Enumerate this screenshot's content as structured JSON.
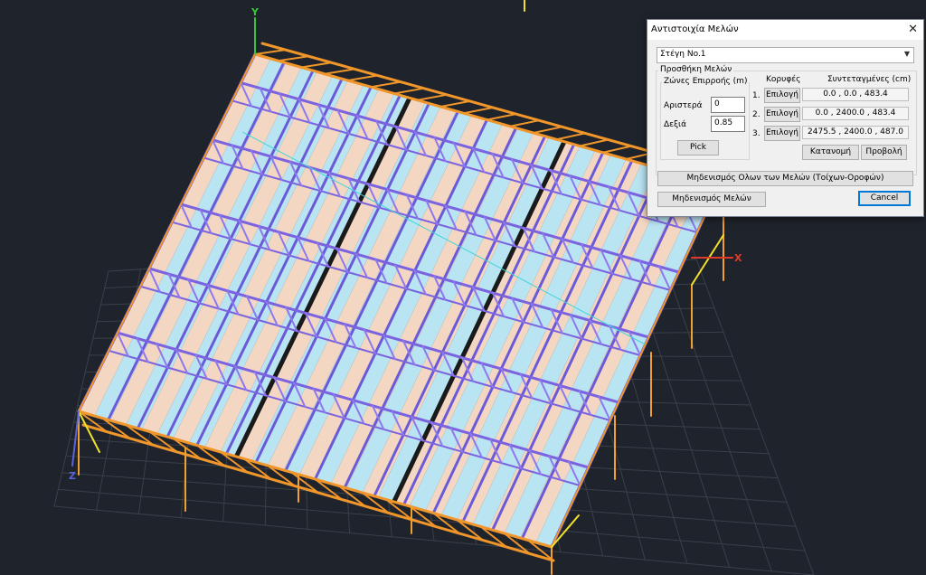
{
  "viewport": {
    "axis_y_label": "Y",
    "axis_x_label": "X",
    "axis_z_label": "Z"
  },
  "dialog": {
    "title": "Αντιστοιχία Μελών",
    "close_glyph": "✕",
    "roof_select": {
      "selected": "Στέγη No.1",
      "arrow": "▼"
    },
    "add_members_group": "Προσθήκη Μελών",
    "influence_zones_group": "Ζώνες Επιρροής (m)",
    "left_label": "Αριστερά",
    "left_value": "0",
    "right_label": "Δεξιά",
    "right_value": "0.85",
    "pick_button": "Pick",
    "vertices_header": "Κορυφές",
    "coords_header": "Συντεταγμένες (cm)",
    "vertices": [
      {
        "index": "1.",
        "button": "Επιλογή",
        "coords": "0.0 , 0.0 , 483.4"
      },
      {
        "index": "2.",
        "button": "Επιλογή",
        "coords": "0.0 , 2400.0 , 483.4"
      },
      {
        "index": "3.",
        "button": "Επιλογή",
        "coords": "2475.5 , 2400.0 , 487.0"
      }
    ],
    "distribute_button": "Κατανομή",
    "show_button": "Προβολή",
    "reset_all_button": "Μηδενισμός Ολων των Μελών (Τοίχων-Οροφών)",
    "reset_members_button": "Μηδενισμός Μελών",
    "cancel_button": "Cancel"
  }
}
